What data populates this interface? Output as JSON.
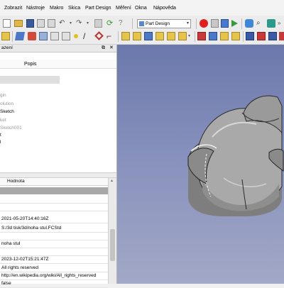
{
  "menu": [
    "Zobrazit",
    "Nástroje",
    "Makro",
    "Skica",
    "Part Design",
    "Měření",
    "Okna",
    "Nápověda"
  ],
  "toolbar": {
    "workbench": "Part Design"
  },
  "panel": {
    "title_fragment": "azení",
    "column_header": "Popis",
    "tree_fragments": [
      "gin",
      "olution",
      "Sketch",
      "ket",
      "Sketch001",
      "t",
      "l"
    ]
  },
  "properties": {
    "header": "Hodnota",
    "values": [
      "",
      "2021-05-20T14:40:16Z",
      "S:/3d tisk/3d/noha stul.FCStd",
      "",
      "noha stul",
      "",
      "2023-12-02T15:21:47Z",
      "All rights reserved",
      "http://en.wikipedia.org/wiki/All_rights_reserved",
      "false"
    ]
  },
  "colors": {
    "viewport_top": "#6b78ab",
    "viewport_bottom": "#a2a8c6",
    "model": "#b2b2b2",
    "record": "#e02020"
  }
}
